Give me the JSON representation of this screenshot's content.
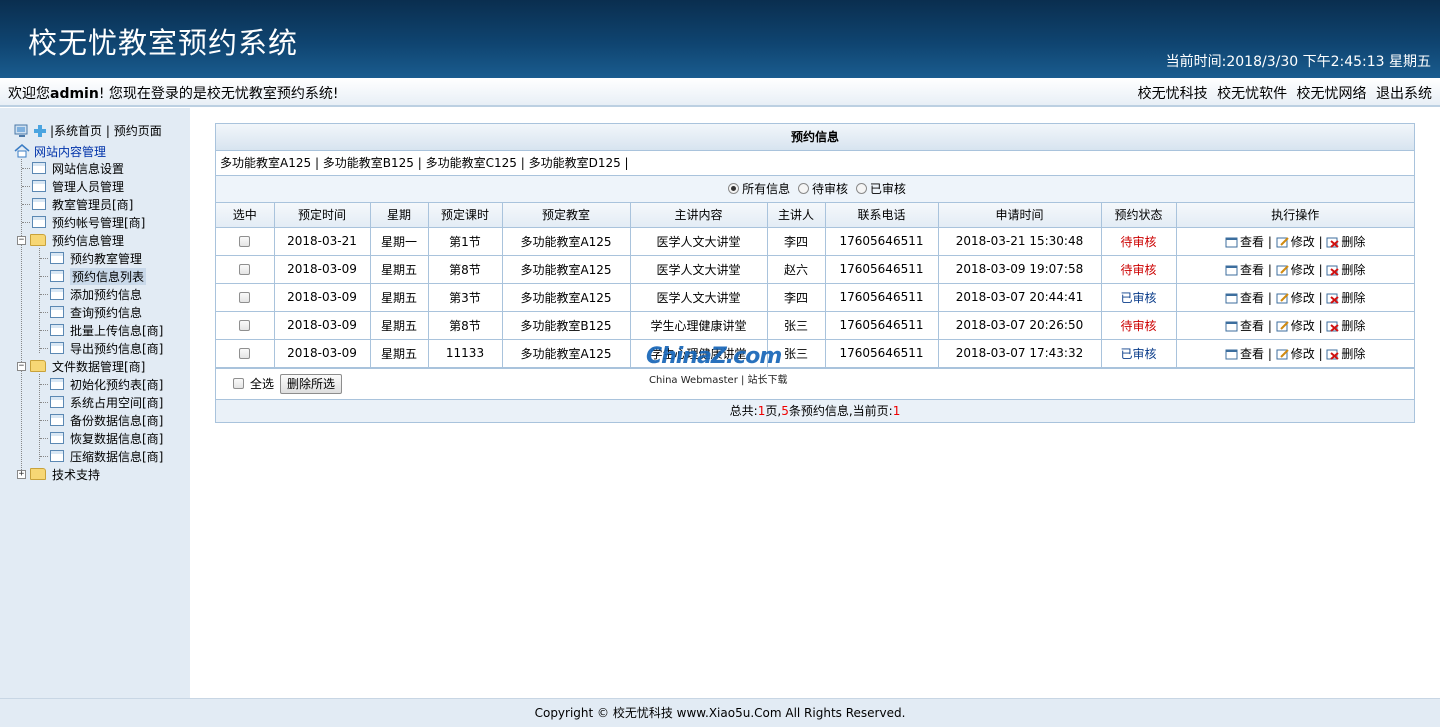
{
  "header": {
    "title": "校无忧教室预约系统",
    "clock_label": "当前时间:",
    "clock_value": "2018/3/30 下午2:45:13 星期五"
  },
  "welcome": {
    "prefix": "欢迎您",
    "user": "admin",
    "suffix": "! 您现在登录的是校无忧教室预约系统!",
    "links": [
      "校无忧科技",
      "校无忧软件",
      "校无忧网络",
      "退出系统"
    ]
  },
  "sidebar": {
    "top_links": [
      "系统首页",
      "预约页面"
    ],
    "root": "网站内容管理",
    "items": [
      "网站信息设置",
      "管理人员管理",
      "教室管理员[商]",
      "预约帐号管理[商]"
    ],
    "group1": {
      "label": "预约信息管理",
      "items": [
        "预约教室管理",
        "预约信息列表",
        "添加预约信息",
        "查询预约信息",
        "批量上传信息[商]",
        "导出预约信息[商]"
      ]
    },
    "group2": {
      "label": "文件数据管理[商]",
      "items": [
        "初始化预约表[商]",
        "系统占用空间[商]",
        "备份数据信息[商]",
        "恢复数据信息[商]",
        "压缩数据信息[商]"
      ]
    },
    "group3": {
      "label": "技术支持"
    }
  },
  "main": {
    "panel_title": "预约信息",
    "rooms": [
      "多功能教室A125",
      "多功能教室B125",
      "多功能教室C125",
      "多功能教室D125"
    ],
    "filters": [
      "所有信息",
      "待审核",
      "已审核"
    ],
    "columns": [
      "选中",
      "预定时间",
      "星期",
      "预定课时",
      "预定教室",
      "主讲内容",
      "主讲人",
      "联系电话",
      "申请时间",
      "预约状态",
      "执行操作"
    ],
    "rows": [
      {
        "date": "2018-03-21",
        "weekday": "星期一",
        "period": "第1节",
        "room": "多功能教室A125",
        "topic": "医学人文大讲堂",
        "speaker": "李四",
        "phone": "17605646511",
        "applied": "2018-03-21 15:30:48",
        "status": "待审核"
      },
      {
        "date": "2018-03-09",
        "weekday": "星期五",
        "period": "第8节",
        "room": "多功能教室A125",
        "topic": "医学人文大讲堂",
        "speaker": "赵六",
        "phone": "17605646511",
        "applied": "2018-03-09 19:07:58",
        "status": "待审核"
      },
      {
        "date": "2018-03-09",
        "weekday": "星期五",
        "period": "第3节",
        "room": "多功能教室A125",
        "topic": "医学人文大讲堂",
        "speaker": "李四",
        "phone": "17605646511",
        "applied": "2018-03-07 20:44:41",
        "status": "已审核"
      },
      {
        "date": "2018-03-09",
        "weekday": "星期五",
        "period": "第8节",
        "room": "多功能教室B125",
        "topic": "学生心理健康讲堂",
        "speaker": "张三",
        "phone": "17605646511",
        "applied": "2018-03-07 20:26:50",
        "status": "待审核"
      },
      {
        "date": "2018-03-09",
        "weekday": "星期五",
        "period": "11133",
        "room": "多功能教室A125",
        "topic": "学生心理健康讲堂",
        "speaker": "张三",
        "phone": "17605646511",
        "applied": "2018-03-07 17:43:32",
        "status": "已审核"
      }
    ],
    "ops": [
      "查看",
      "修改",
      "删除"
    ],
    "select_all": "全选",
    "delete_selected": "删除所选",
    "pager": {
      "total_label": "总共:",
      "pages": "1",
      "pages_unit": "页,",
      "count": "5",
      "count_unit": "条预约信息,当前页:",
      "current": "1"
    }
  },
  "watermark": {
    "logo": "ChinaZ.com",
    "sub": "China Webmaster | 站长下载"
  },
  "footer": {
    "text": "Copyright © 校无忧科技 www.Xiao5u.Com All Rights Reserved."
  },
  "colors": {
    "header": "#0f4470",
    "pending": "#cc0000",
    "approved": "#0a3c8a",
    "accent_red": "#ee0000"
  }
}
